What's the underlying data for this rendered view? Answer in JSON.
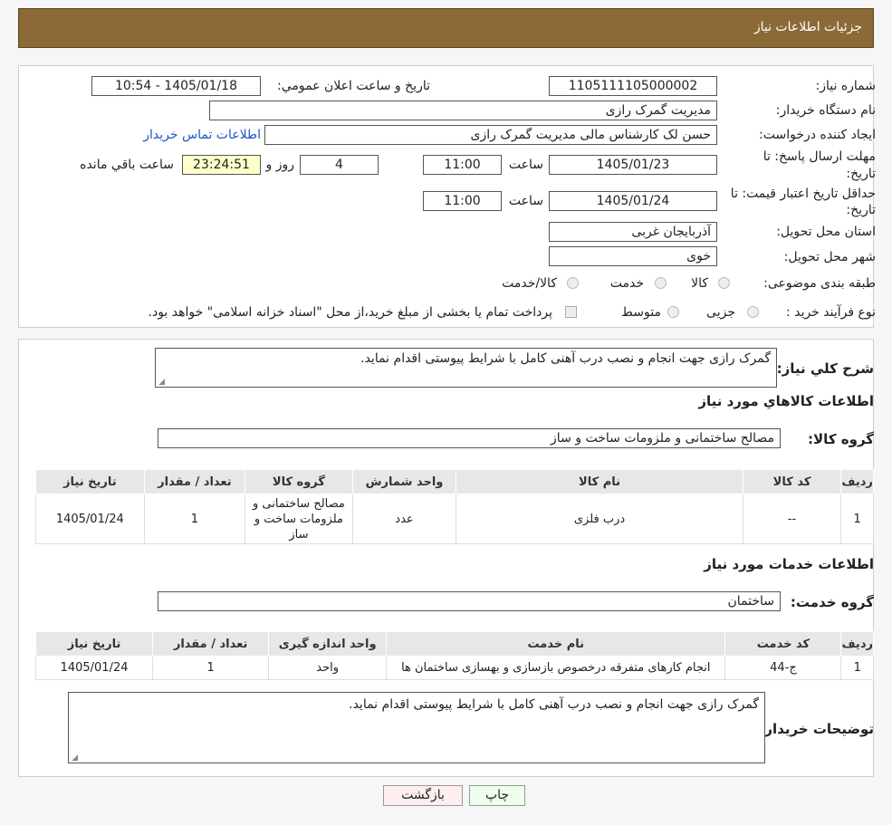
{
  "header": {
    "title": "جزئیات اطلاعات نیاز"
  },
  "fields": {
    "need_number_label": "شماره نیاز:",
    "need_number": "1105111105000002",
    "announce_label": "تاریخ و ساعت اعلان عمومي:",
    "announce_value": "1405/01/18 - 10:54",
    "buyer_org_label": "نام دستگاه خريدار:",
    "buyer_org": "مدیریت گمرک رازی",
    "creator_label": "ايجاد کننده درخواست:",
    "creator": "حسن لک کارشناس مالی مدیریت گمرک رازی",
    "contact_link": "اطلاعات تماس خريدار",
    "reply_deadline_label_1": "مهلت ارسال پاسخ: تا",
    "reply_deadline_label_2": "تاريخ:",
    "reply_date": "1405/01/23",
    "time_label": "ساعت",
    "reply_time": "11:00",
    "days_value": "4",
    "days_label": "روز و",
    "remaining_time": "23:24:51",
    "remaining_label": "ساعت باقي مانده",
    "price_validity_label_1": "حداقل تاريخ اعتبار قيمت: تا",
    "price_validity_label_2": "تاريخ:",
    "price_date": "1405/01/24",
    "price_time": "11:00",
    "province_label": "استان محل تحويل:",
    "province": "آذربایجان غربی",
    "city_label": "شهر محل تحويل:",
    "city": "خوی",
    "category_label": "طبقه بندی موضوعی:",
    "category_options": [
      "کالا",
      "خدمت",
      "کالا/خدمت"
    ],
    "process_label": "نوع فرآیند خرید :",
    "process_options": [
      "جزیی",
      "متوسط"
    ],
    "payment_note": "پرداخت تمام يا بخشی از مبلغ خريد،از محل \"اسناد خزانه اسلامی\" خواهد بود."
  },
  "description": {
    "label": "شرح کلي نياز:",
    "text": "گمرک رازی جهت انجام و نصب درب آهنی کامل با شرایط پیوستی اقدام نماید."
  },
  "goods": {
    "section_title": "اطلاعات کالاهاي مورد نياز",
    "group_label": "گروه کالا:",
    "group_value": "مصالح ساختمانی و ملزومات ساخت و ساز",
    "headers": [
      "رديف",
      "کد کالا",
      "نام کالا",
      "واحد شمارش",
      "گروه کالا",
      "تعداد / مقدار",
      "تاريخ نياز"
    ],
    "rows": [
      [
        "1",
        "--",
        "درب فلزی",
        "عدد",
        "مصالح ساختمانی و ملزومات ساخت و ساز",
        "1",
        "1405/01/24"
      ]
    ]
  },
  "services": {
    "section_title": "اطلاعات خدمات مورد نياز",
    "group_label": "گروه خدمت:",
    "group_value": "ساختمان",
    "headers": [
      "رديف",
      "کد خدمت",
      "نام خدمت",
      "واحد اندازه گيری",
      "تعداد / مقدار",
      "تاريخ نياز"
    ],
    "rows": [
      [
        "1",
        "ج-44",
        "انجام کارهای متفرقه درخصوص بازسازی و بهسازی ساختمان ها",
        "واحد",
        "1",
        "1405/01/24"
      ]
    ]
  },
  "buyer_notes": {
    "label": "توضيحات خريدار:",
    "text": "گمرک رازی جهت انجام و نصب درب آهنی کامل با شرایط پیوستی اقدام نماید."
  },
  "buttons": {
    "print": "چاپ",
    "back": "بازگشت"
  },
  "colors": {
    "header_bg": "#8b6a38",
    "print_bg": "#eeffee",
    "back_bg": "#ffeeee",
    "link": "#1a55c6"
  }
}
